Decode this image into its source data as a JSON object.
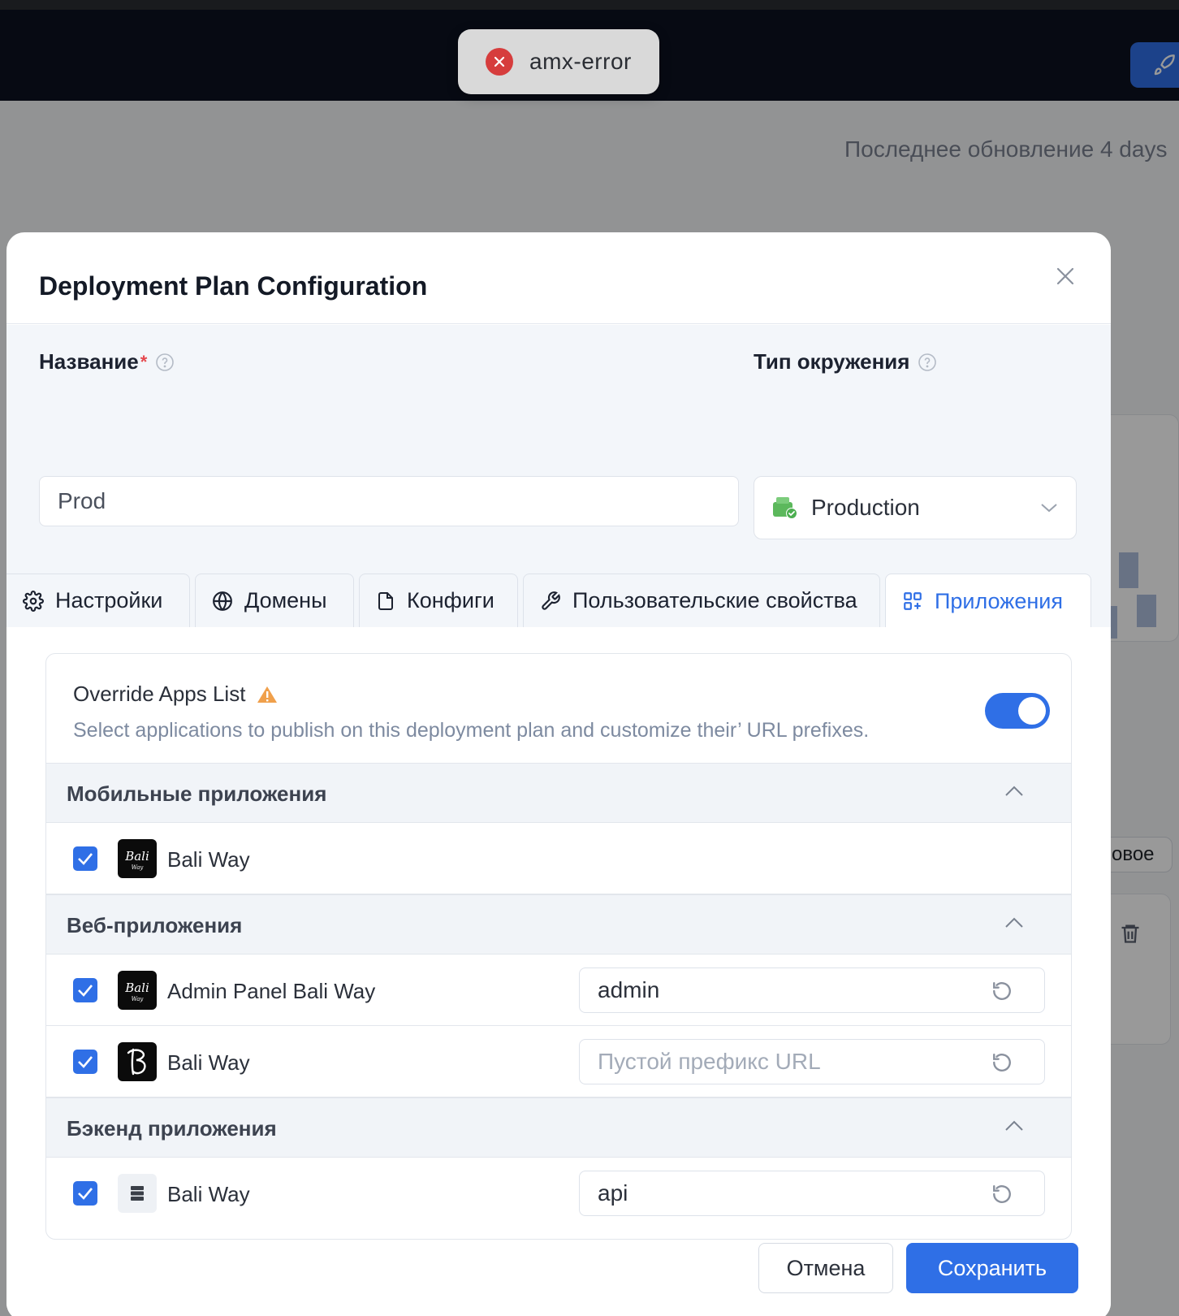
{
  "toast": {
    "text": "amx-error",
    "icon": "error-circle-icon",
    "color": "#d63d3d"
  },
  "background": {
    "last_update": "Последнее обновление 4 days",
    "tag_text": "овое"
  },
  "modal": {
    "title": "Deployment Plan Configuration",
    "name_field": {
      "label": "Название",
      "required_mark": "*",
      "value": "Prod"
    },
    "env_field": {
      "label": "Тип окружения",
      "value": "Production",
      "icon": "production-box-icon"
    },
    "tabs": [
      {
        "label": "Настройки",
        "icon": "gear-icon"
      },
      {
        "label": "Домены",
        "icon": "globe-icon"
      },
      {
        "label": "Конфиги",
        "icon": "file-icon"
      },
      {
        "label": "Пользовательские свойства",
        "icon": "wrench-icon"
      },
      {
        "label": "Приложения",
        "icon": "apps-grid-icon",
        "active": true
      }
    ],
    "override": {
      "title": "Override Apps List",
      "description": "Select applications to publish on this deployment plan and customize their’ URL prefixes.",
      "enabled": true
    },
    "groups": [
      {
        "title": "Мобильные приложения",
        "apps": [
          {
            "name": "Bali Way",
            "checked": true
          }
        ]
      },
      {
        "title": "Веб-приложения",
        "apps": [
          {
            "name": "Admin Panel Bali Way",
            "checked": true,
            "prefix": "admin",
            "placeholder": ""
          },
          {
            "name": "Bali Way",
            "checked": true,
            "prefix": "",
            "placeholder": "Пустой префикс URL"
          }
        ]
      },
      {
        "title": "Бэкенд приложения",
        "apps": [
          {
            "name": "Bali Way",
            "checked": true,
            "prefix": "api",
            "placeholder": ""
          }
        ]
      }
    ],
    "cancel_label": "Отмена",
    "save_label": "Сохранить"
  },
  "colors": {
    "accent": "#2f6fe6",
    "header_bg": "#0c1220",
    "danger": "#d63d3d",
    "warning": "#f0a04b"
  }
}
